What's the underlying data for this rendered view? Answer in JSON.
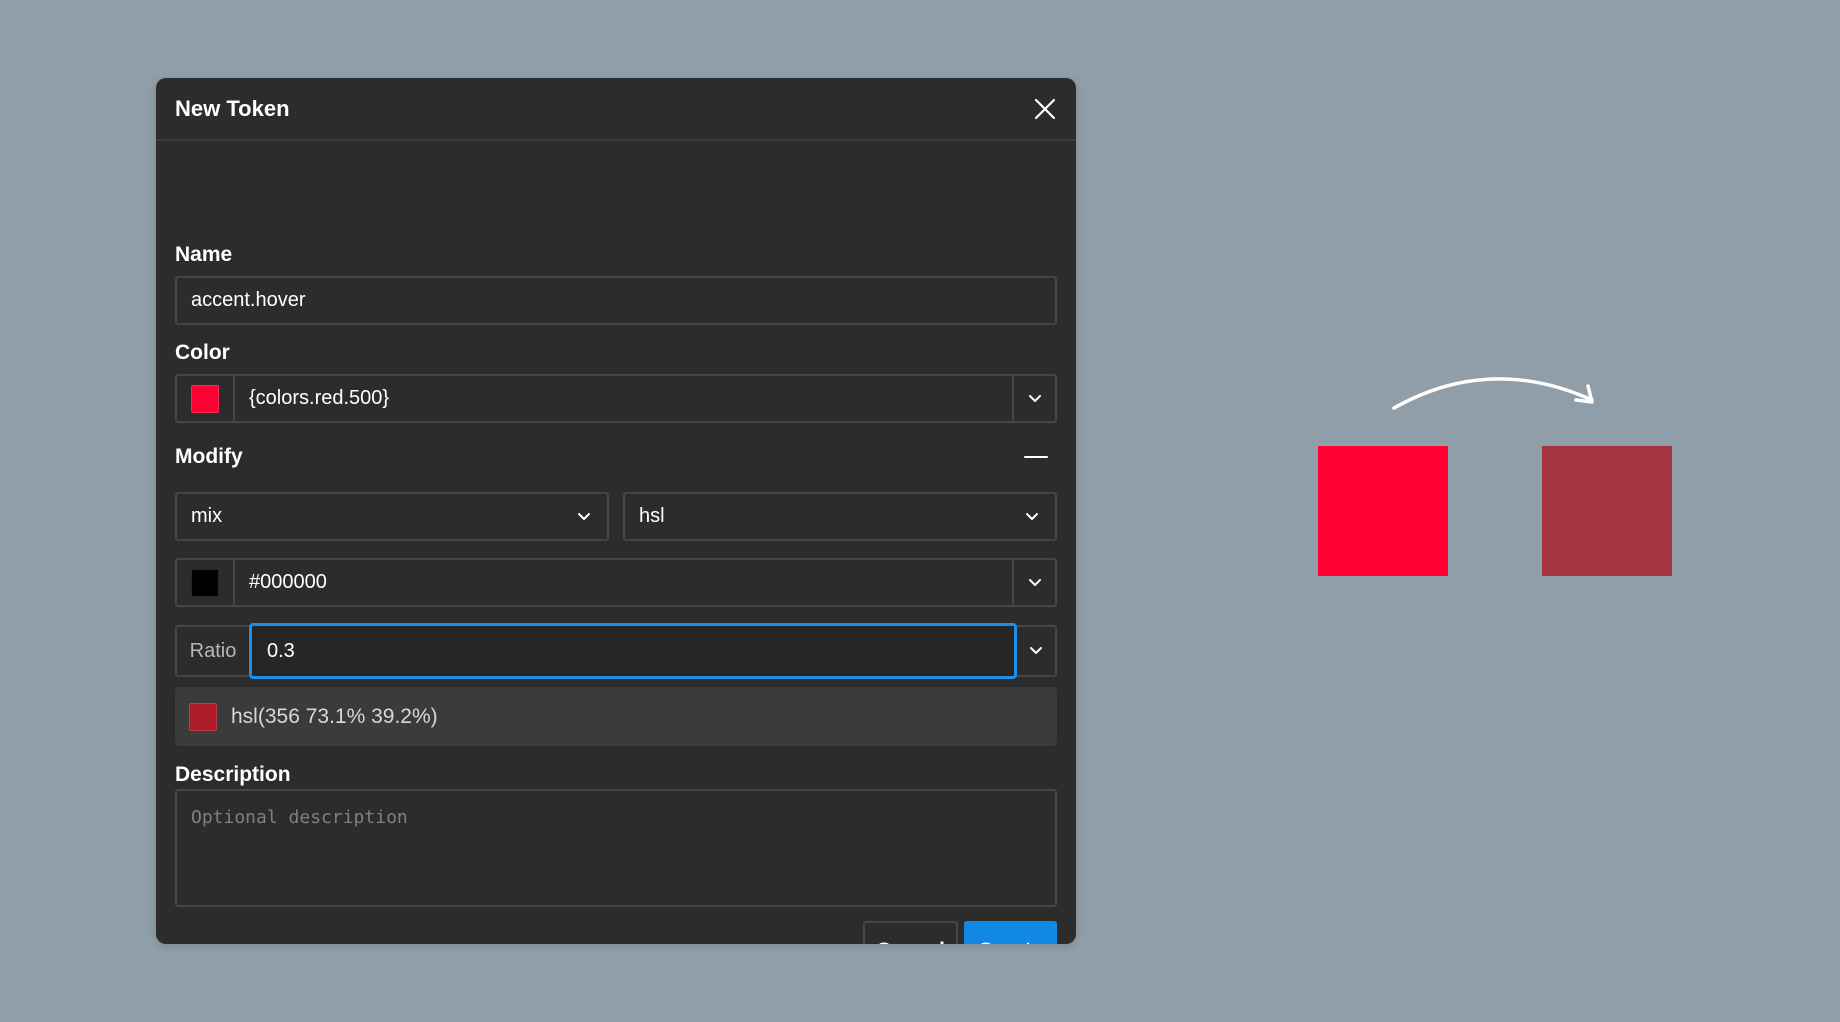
{
  "dialog": {
    "title": "New Token",
    "name_label": "Name",
    "name_value": "accent.hover",
    "color_label": "Color",
    "color_value": "{colors.red.500}",
    "color_swatch": "#ff0033",
    "modify_label": "Modify",
    "modify_type": "mix",
    "modify_space": "hsl",
    "mix_color_value": "#000000",
    "mix_color_swatch": "#000000",
    "ratio_label": "Ratio",
    "ratio_value": "0.3",
    "result_text": "hsl(356 73.1% 39.2%)",
    "result_swatch": "#ad1b26",
    "description_label": "Description",
    "description_placeholder": "Optional description",
    "cancel_label": "Cancel",
    "create_label": "Create"
  },
  "preview": {
    "source_color": "#ff0033",
    "result_color": "#a33540"
  },
  "colors": {
    "background": "#8f9ea9",
    "dialog_bg": "#2c2c2c",
    "accent": "#1288e5",
    "focus_ring": "#1e8ee6"
  },
  "icons": {
    "close": "close-icon",
    "caret": "chevron-down-icon",
    "collapse": "minus-icon",
    "arrow": "curved-arrow-icon"
  }
}
